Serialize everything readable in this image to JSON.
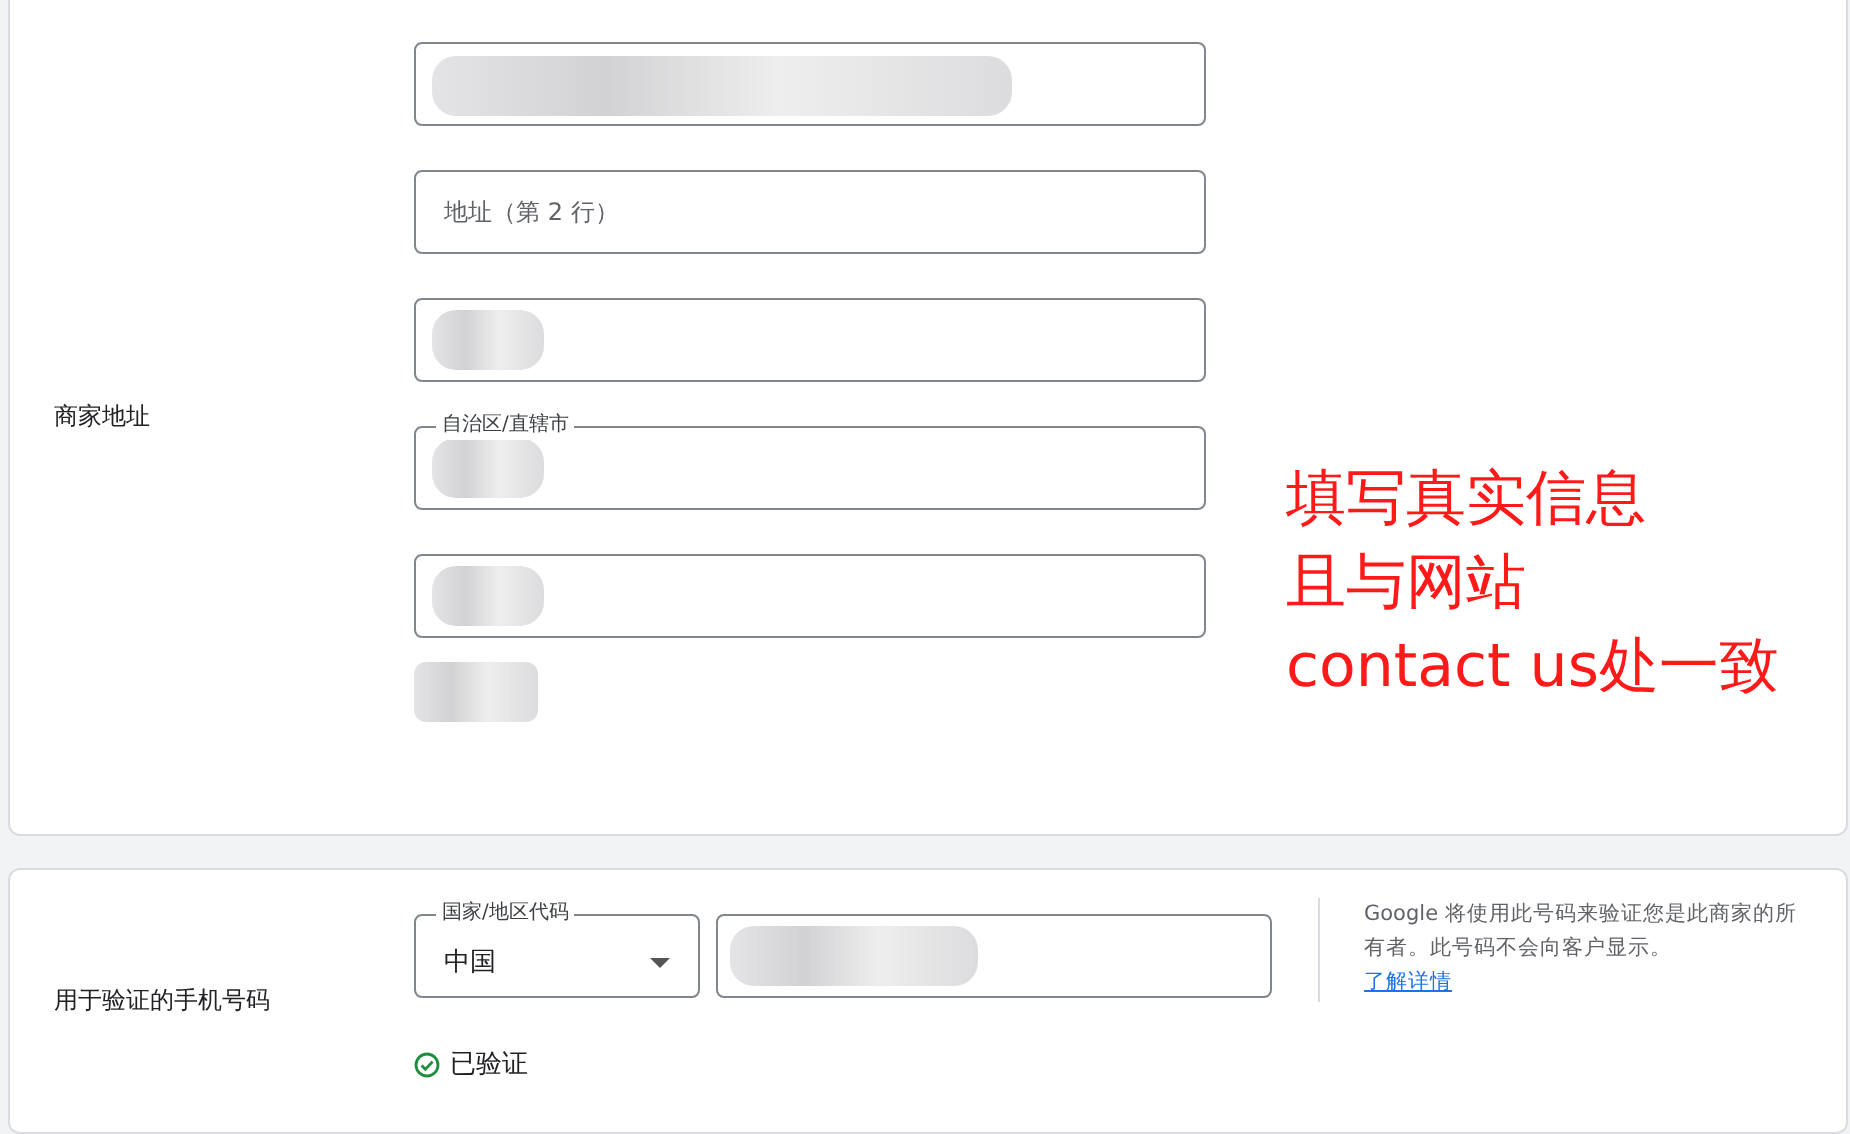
{
  "address_section": {
    "label": "商家地址",
    "fields": [
      {
        "redacted": true
      },
      {
        "placeholder": "地址（第 2 行）",
        "redacted": false
      },
      {
        "redacted": true
      },
      {
        "label": "自治区/直辖市",
        "redacted": true
      },
      {
        "redacted": true
      }
    ],
    "extra_redacted": true
  },
  "annotation": {
    "lines": [
      "填写真实信息",
      "且与网站",
      "contact us处一致"
    ]
  },
  "phone_section": {
    "label": "用于验证的手机号码",
    "country_field": {
      "label": "国家/地区代码",
      "value": "中国"
    },
    "phone_field": {
      "redacted": true
    },
    "help_text": "Google 将使用此号码来验证您是此商家的所有者。此号码不会向客户显示。",
    "help_link": "了解详情",
    "status": "已验证"
  }
}
